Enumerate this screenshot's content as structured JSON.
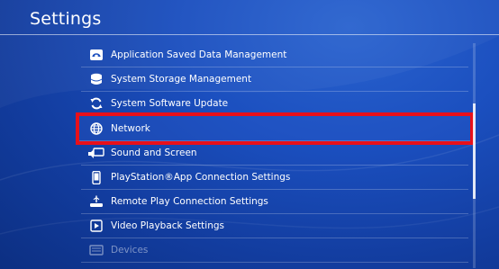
{
  "header": {
    "title": "Settings"
  },
  "menu": {
    "items": [
      {
        "label": "Application Saved Data Management",
        "icon": "save-data-icon"
      },
      {
        "label": "System Storage Management",
        "icon": "storage-icon"
      },
      {
        "label": "System Software Update",
        "icon": "update-icon"
      },
      {
        "label": "Network",
        "icon": "globe-icon",
        "selected": true
      },
      {
        "label": "Sound and Screen",
        "icon": "sound-screen-icon"
      },
      {
        "label": "PlayStation®App Connection Settings",
        "icon": "phone-icon"
      },
      {
        "label": "Remote Play Connection Settings",
        "icon": "remote-play-icon"
      },
      {
        "label": "Video Playback Settings",
        "icon": "video-playback-icon"
      },
      {
        "label": "Devices",
        "icon": "devices-icon"
      }
    ]
  },
  "colors": {
    "selection_outline": "#e8101a",
    "background": "#1b4fbf"
  }
}
